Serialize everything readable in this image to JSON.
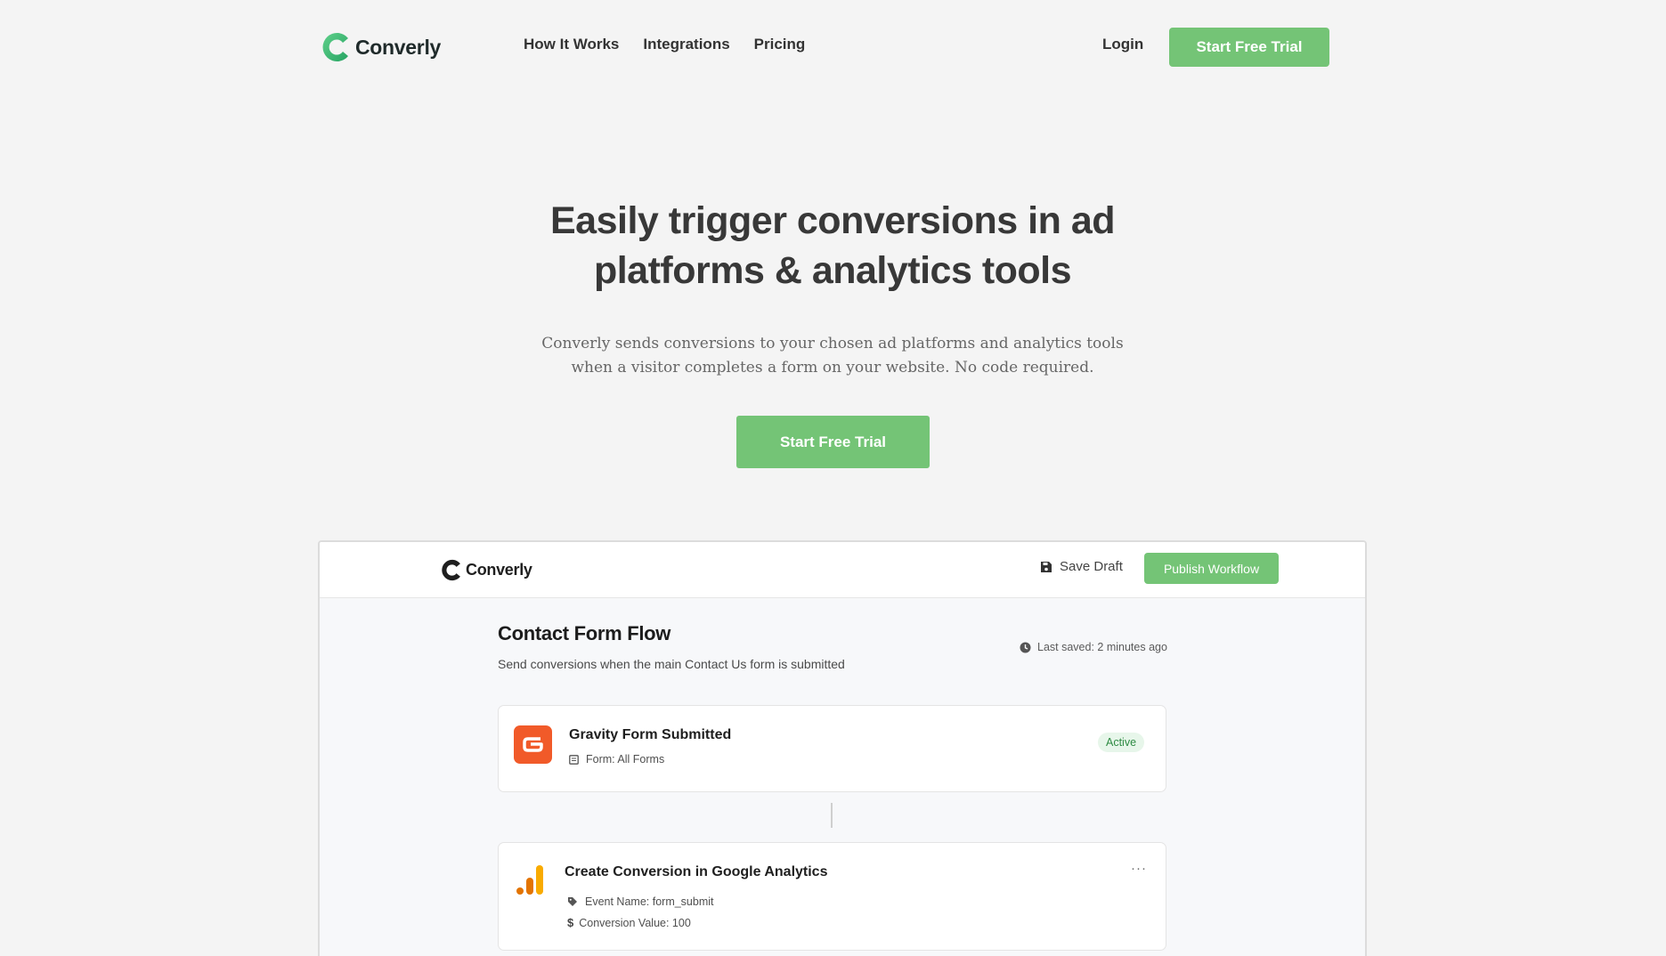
{
  "brand": {
    "name": "Converly",
    "logo_icon": "converly-c-logo-icon"
  },
  "nav": {
    "links": [
      "How It Works",
      "Integrations",
      "Pricing"
    ],
    "login": "Login",
    "cta": "Start Free Trial"
  },
  "hero": {
    "title_line1": "Easily trigger conversions in ad",
    "title_line2": "platforms & analytics tools",
    "subtitle_line1": "Converly sends conversions to your chosen ad platforms and analytics tools",
    "subtitle_line2": "when a visitor completes a form on your website. No code required.",
    "cta": "Start Free Trial"
  },
  "app": {
    "brand": "Converly",
    "save_draft": "Save Draft",
    "publish": "Publish Workflow",
    "flow_title": "Contact Form Flow",
    "flow_description": "Send conversions when the main Contact Us form is submitted",
    "last_saved": "Last saved: 2 minutes ago",
    "trigger": {
      "icon": "gravity-forms-icon",
      "title": "Gravity Form Submitted",
      "form": "Form: All Forms",
      "status": "Active"
    },
    "action": {
      "icon": "google-analytics-icon",
      "title": "Create Conversion in Google Analytics",
      "event_name": "Event Name: form_submit",
      "conversion_value": "Conversion Value: 100",
      "more": "···"
    }
  },
  "colors": {
    "accent_green": "#74c476",
    "logo_green": "#3cb878",
    "background": "#f4f4f4",
    "gravity_orange": "#f15a29",
    "ga_orange": "#f9ab00",
    "ga_dark_orange": "#e37400"
  }
}
